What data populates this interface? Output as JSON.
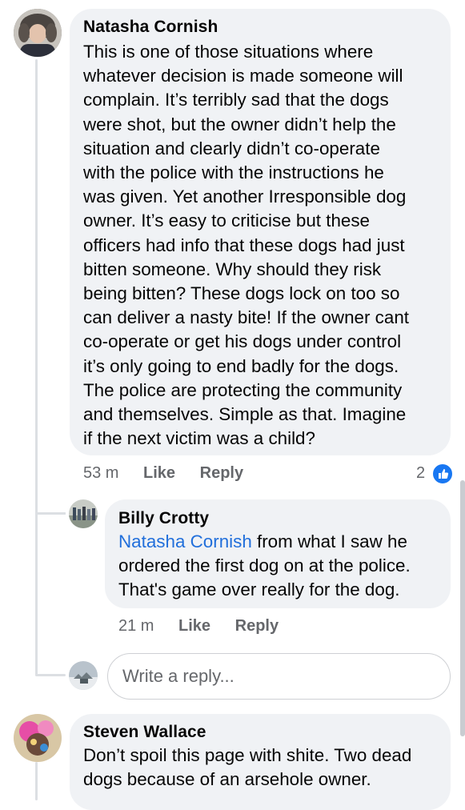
{
  "comments": [
    {
      "author": "Natasha Cornish",
      "lines": [
        "This is one of those situations where",
        "whatever decision is made someone will",
        "complain. It’s terribly sad that the dogs",
        "were shot, but the owner didn’t help the",
        "situation and clearly didn’t co-operate",
        "with the police with the instructions he",
        "was given. Yet another Irresponsible dog",
        "owner. It’s easy to criticise but these",
        "officers had info that these dogs had just",
        "bitten someone. Why should they risk",
        "being bitten? These dogs lock on too so",
        "can deliver a nasty bite! If the owner cant",
        "co-operate or get his dogs under control",
        "it’s only going to end badly for the dogs.",
        "The police are protecting the community",
        "and themselves. Simple as that. Imagine",
        "if the next victim was a child?"
      ],
      "time": "53 m",
      "like_label": "Like",
      "reply_label": "Reply",
      "reaction_count": "2",
      "reaction_icon": "like-icon",
      "accent": "#1877f2"
    },
    {
      "author": "Billy Crotty",
      "mention": "Natasha Cornish",
      "first_line_rest": " from what I saw he",
      "lines": [
        "ordered the first dog on at the police.",
        "That's game over really for the dog."
      ],
      "time": "21 m",
      "like_label": "Like",
      "reply_label": "Reply"
    },
    {
      "author": "Steven Wallace",
      "lines": [
        "Don’t spoil this page with shite. Two dead",
        "dogs because of an arsehole owner."
      ]
    }
  ],
  "reply_box": {
    "placeholder": "Write a reply..."
  },
  "colors": {
    "bubble": "#f0f2f5",
    "mention": "#216fdb",
    "meta": "#65676b",
    "thread_line": "#dcdfe3"
  }
}
